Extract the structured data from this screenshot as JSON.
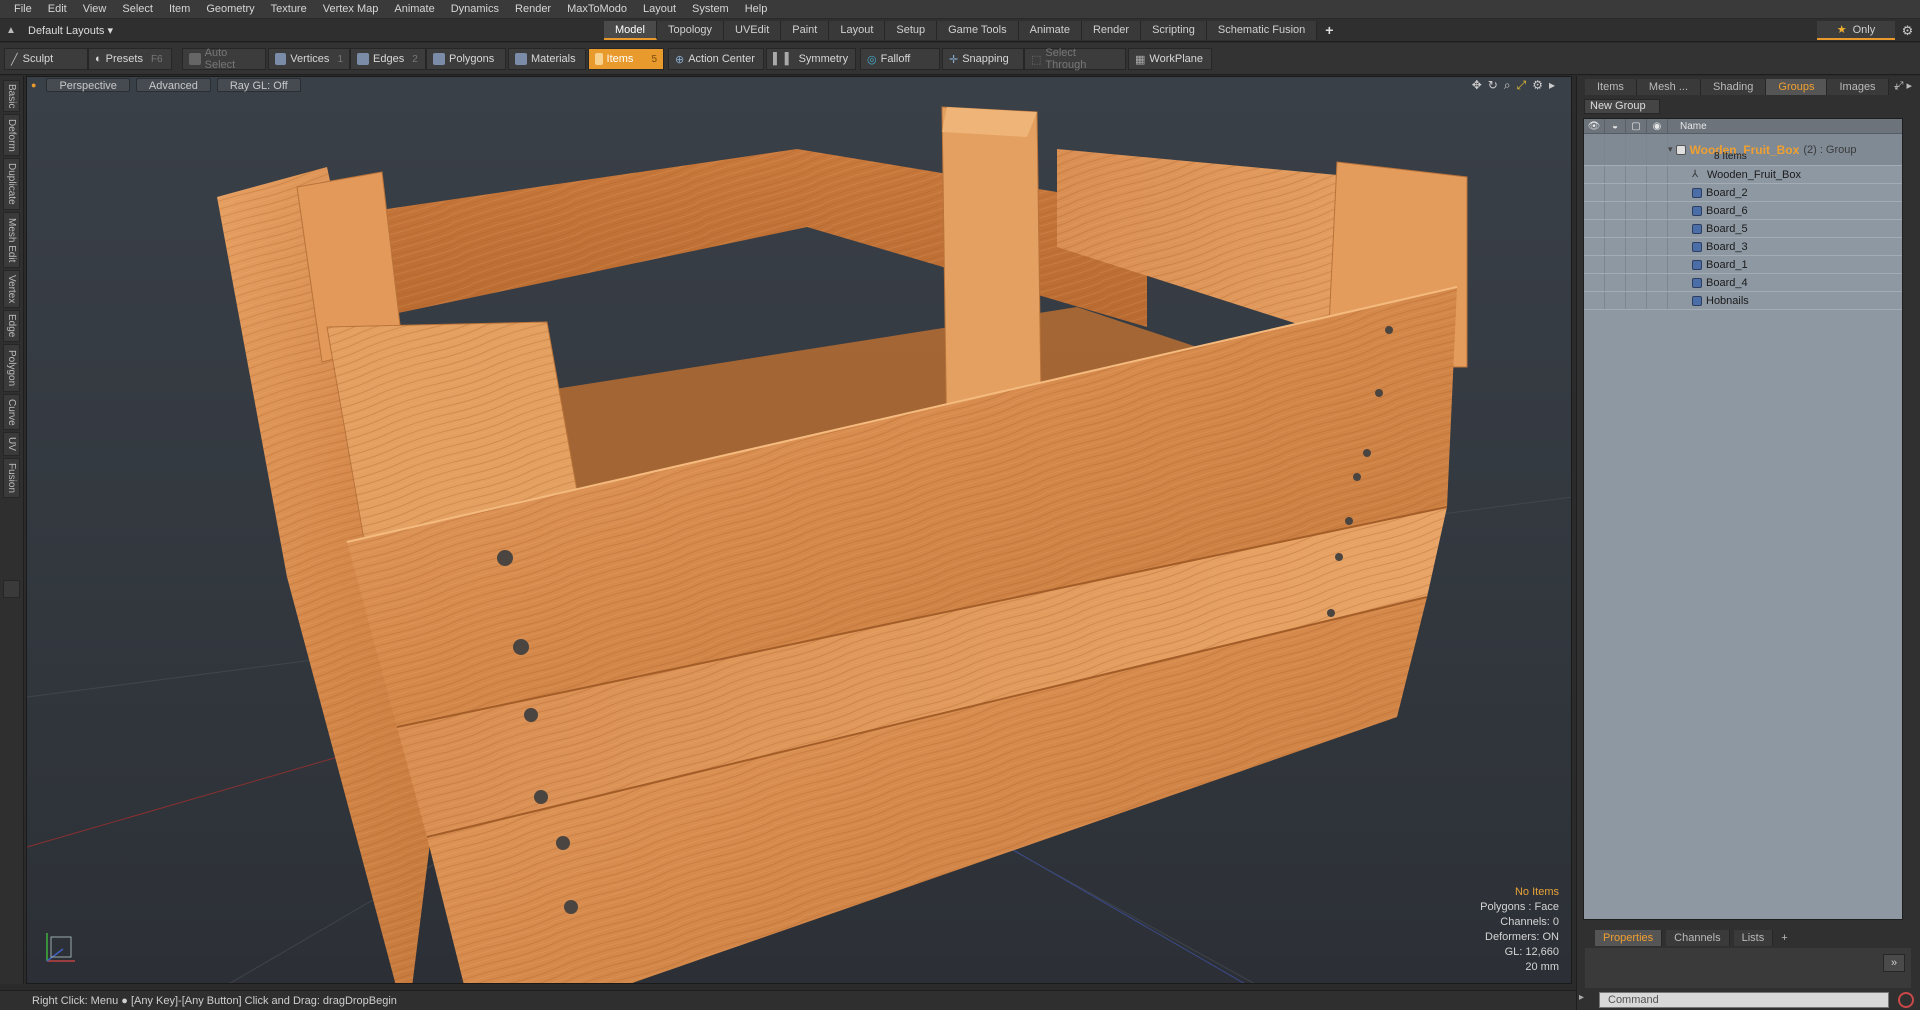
{
  "menu": [
    "File",
    "Edit",
    "View",
    "Select",
    "Item",
    "Geometry",
    "Texture",
    "Vertex Map",
    "Animate",
    "Dynamics",
    "Render",
    "MaxToModo",
    "Layout",
    "System",
    "Help"
  ],
  "layout": {
    "label": "Default Layouts ▾"
  },
  "tabs": [
    "Model",
    "Topology",
    "UVEdit",
    "Paint",
    "Layout",
    "Setup",
    "Game Tools",
    "Animate",
    "Render",
    "Scripting",
    "Schematic Fusion"
  ],
  "only_label": "Only",
  "toolbar": {
    "sculpt": "Sculpt",
    "presets": "Presets",
    "presets_key": "F6",
    "auto_select": "Auto Select",
    "vertices": "Vertices",
    "vertices_key": "1",
    "edges": "Edges",
    "edges_key": "2",
    "polygons": "Polygons",
    "materials": "Materials",
    "items": "Items",
    "items_key": "5",
    "action_center": "Action Center",
    "symmetry": "Symmetry",
    "falloff": "Falloff",
    "snapping": "Snapping",
    "select_through": "Select Through",
    "workplane": "WorkPlane"
  },
  "left_tabs": [
    "Basic",
    "Deform",
    "Duplicate",
    "Mesh Edit",
    "Vertex",
    "Edge",
    "Polygon",
    "Curve",
    "UV",
    "Fusion"
  ],
  "viewport": {
    "perspective": "Perspective",
    "advanced": "Advanced",
    "raygl": "Ray GL: Off",
    "info": {
      "no_items": "No Items",
      "polygons": "Polygons : Face",
      "channels": "Channels: 0",
      "deformers": "Deformers: ON",
      "gl": "GL: 12,660",
      "size": "20 mm"
    }
  },
  "status": "Right Click: Menu ● [Any Key]-[Any Button] Click and Drag: dragDropBegin",
  "right_panel": {
    "tabs": [
      "Items",
      "Mesh ...",
      "Shading",
      "Groups",
      "Images"
    ],
    "active_tab": "Groups",
    "new_group": "New Group",
    "name_header": "Name",
    "group": {
      "name": "Wooden_Fruit_Box",
      "type": "(2) : Group",
      "count": "8 Items"
    },
    "children": [
      "Wooden_Fruit_Box",
      "Board_2",
      "Board_6",
      "Board_5",
      "Board_3",
      "Board_1",
      "Board_4",
      "Hobnails"
    ]
  },
  "props": {
    "tabs": [
      "Properties",
      "Channels",
      "Lists"
    ],
    "active_tab": "Properties",
    "command_placeholder": "Command"
  },
  "colors": {
    "accent": "#e89a2c",
    "wood": "#d98a4a",
    "panel_bg": "#8e98a2"
  }
}
